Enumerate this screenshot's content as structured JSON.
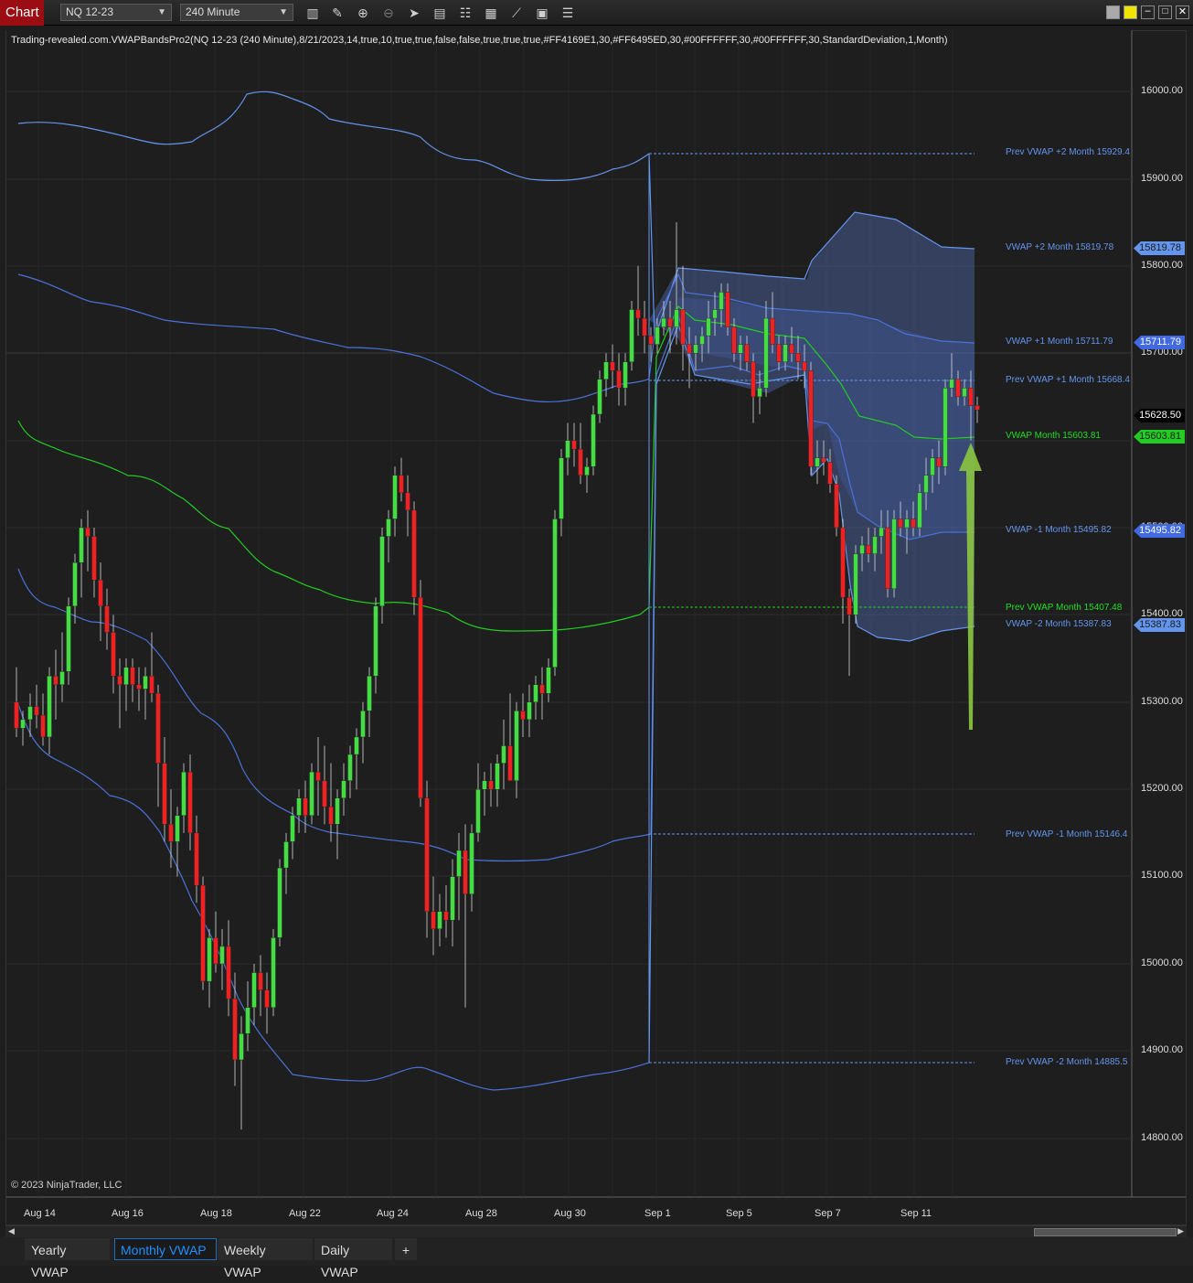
{
  "window": {
    "title": "Chart",
    "instrument": "NQ 12-23",
    "interval": "240 Minute"
  },
  "toolbar_icons": [
    "bar-type-icon",
    "draw-tool-icon",
    "zoom-in-icon",
    "zoom-out-icon",
    "pointer-icon",
    "data-box-icon",
    "properties-icon",
    "indicators-icon",
    "strategies-icon",
    "templates-icon",
    "list-icon"
  ],
  "indicator_title": "Trading-revealed.com.VWAPBandsPro2(NQ 12-23 (240 Minute),8/21/2023,14,true,10,true,true,false,false,true,true,true,#FF4169E1,30,#FF6495ED,30,#00FFFFFF,30,#00FFFFFF,30,StandardDeviation,1,Month)",
  "copyright": "© 2023 NinjaTrader, LLC",
  "y_axis": [
    "16000.00",
    "15900.00",
    "15800.00",
    "15700.00",
    "15600.00",
    "15500.00",
    "15400.00",
    "15300.00",
    "15200.00",
    "15100.00",
    "15000.00",
    "14900.00",
    "14800.00"
  ],
  "x_axis": [
    "Aug 14",
    "Aug 16",
    "Aug 18",
    "Aug 22",
    "Aug 24",
    "Aug 28",
    "Aug 30",
    "Sep 1",
    "Sep 5",
    "Sep 7",
    "Sep 11"
  ],
  "line_labels": [
    {
      "text": "Prev VWAP +2 Month 15929.4",
      "color": "#6495ED"
    },
    {
      "text": "VWAP +2 Month 15819.78",
      "color": "#6495ED"
    },
    {
      "text": "VWAP +1 Month 15711.79",
      "color": "#6495ED"
    },
    {
      "text": "Prev VWAP +1 Month 15668.4",
      "color": "#6495ED"
    },
    {
      "text": "VWAP Month 15603.81",
      "color": "#22dd22"
    },
    {
      "text": "VWAP -1 Month 15495.82",
      "color": "#6495ED"
    },
    {
      "text": "Prev VWAP Month 15407.48",
      "color": "#22dd22"
    },
    {
      "text": "VWAP -2 Month 15387.83",
      "color": "#6495ED"
    },
    {
      "text": "Prev VWAP -1 Month 15146.4",
      "color": "#6495ED"
    },
    {
      "text": "Prev VWAP -2 Month 14885.5",
      "color": "#6495ED"
    }
  ],
  "price_tags": [
    {
      "text": "15819.78",
      "bg": "#6495ED",
      "fg": "#1a1a1a"
    },
    {
      "text": "15711.79",
      "bg": "#4169E1",
      "fg": "#ffffff"
    },
    {
      "text": "15628.50",
      "bg": "#000000",
      "fg": "#ffffff"
    },
    {
      "text": "15603.81",
      "bg": "#22cc22",
      "fg": "#1a1a1a"
    },
    {
      "text": "15495.82",
      "bg": "#4169E1",
      "fg": "#ffffff"
    },
    {
      "text": "15387.83",
      "bg": "#6495ED",
      "fg": "#1a1a1a"
    }
  ],
  "tabs": [
    "Yearly VWAP",
    "Monthly VWAP",
    "Weekly VWAP",
    "Daily VWAP",
    "+"
  ],
  "active_tab": "Monthly VWAP"
}
